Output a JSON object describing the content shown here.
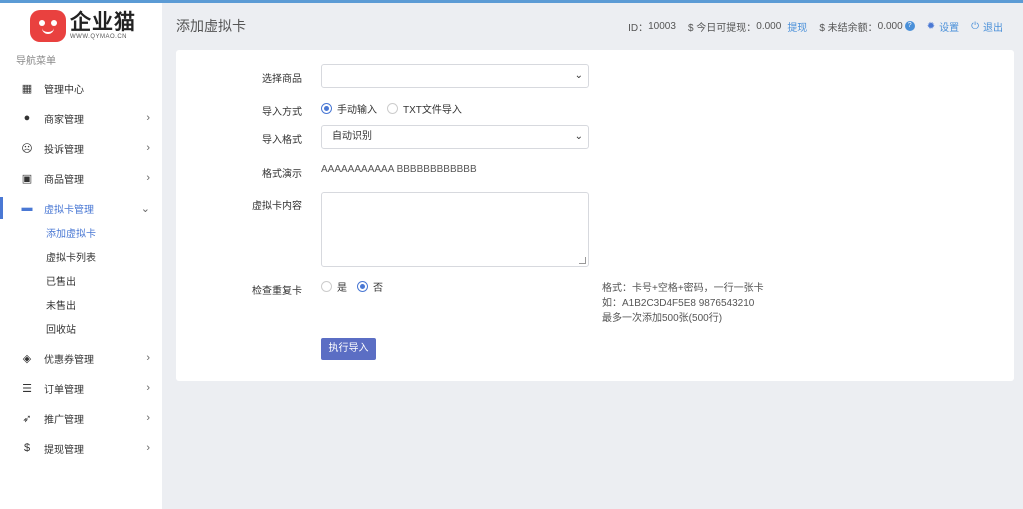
{
  "logo": {
    "cn": "企业猫",
    "en": "WWW.QYMAO.CN"
  },
  "sidebar": {
    "title": "导航菜单",
    "items": [
      {
        "label": "管理中心",
        "icon": "dashboard-icon",
        "glyph": "▦",
        "expandable": false
      },
      {
        "label": "商家管理",
        "icon": "user-icon",
        "glyph": "●",
        "expandable": true
      },
      {
        "label": "投诉管理",
        "icon": "frown-icon",
        "glyph": "☹",
        "expandable": true
      },
      {
        "label": "商品管理",
        "icon": "bag-icon",
        "glyph": "▣",
        "expandable": true
      },
      {
        "label": "虚拟卡管理",
        "icon": "card-icon",
        "glyph": "▬",
        "expandable": true,
        "expanded": true
      },
      {
        "label": "优惠券管理",
        "icon": "ticket-icon",
        "glyph": "◈",
        "expandable": true
      },
      {
        "label": "订单管理",
        "icon": "list-icon",
        "glyph": "☰",
        "expandable": true
      },
      {
        "label": "推广管理",
        "icon": "send-icon",
        "glyph": "➶",
        "expandable": true
      },
      {
        "label": "提现管理",
        "icon": "dollar-icon",
        "glyph": "$",
        "expandable": true
      }
    ],
    "sub_items": [
      "添加虚拟卡",
      "虚拟卡列表",
      "已售出",
      "未售出",
      "回收站"
    ]
  },
  "header": {
    "title": "添加虚拟卡",
    "id_label": "ID：",
    "id_value": "10003",
    "today_label": "$ 今日可提现：",
    "today_value": "0.000",
    "withdraw_link": "提现",
    "unsettled_label": "$ 未结余额：",
    "unsettled_value": "0.000",
    "help": "?",
    "settings": "设置",
    "logout": "退出"
  },
  "form": {
    "product_label": "选择商品",
    "product_value": "",
    "import_mode_label": "导入方式",
    "import_modes": [
      "手动输入",
      "TXT文件导入"
    ],
    "import_mode_selected": 0,
    "format_label": "导入格式",
    "format_value": "自动识别",
    "demo_label": "格式演示",
    "demo_value": "AAAAAAAAAAA BBBBBBBBBBBB",
    "content_label": "虚拟卡内容",
    "content_value": "",
    "dup_label": "检查重复卡",
    "dup_options": [
      "是",
      "否"
    ],
    "dup_selected": 1,
    "hint_lines": [
      "格式：卡号+空格+密码，一行一张卡",
      "如：A1B2C3D4F5E8 9876543210",
      "最多一次添加500张(500行)"
    ],
    "submit": "执行导入"
  },
  "colors": {
    "accent": "#4a78d4",
    "button": "#5b6ec4",
    "background": "#eceef2"
  }
}
